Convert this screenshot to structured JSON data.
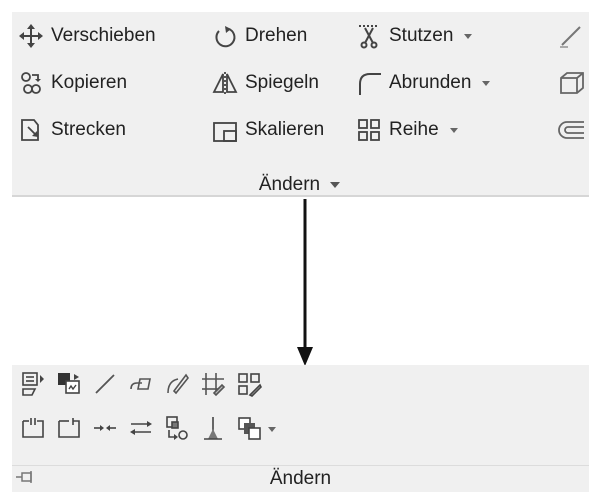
{
  "top_panel": {
    "tools": [
      {
        "label": "Verschieben",
        "icon": "move-icon"
      },
      {
        "label": "Drehen",
        "icon": "rotate-icon"
      },
      {
        "label": "Stutzen",
        "icon": "trim-icon",
        "dropdown": true
      },
      {
        "label": "Kopieren",
        "icon": "copy-icon"
      },
      {
        "label": "Spiegeln",
        "icon": "mirror-icon"
      },
      {
        "label": "Abrunden",
        "icon": "fillet-icon",
        "dropdown": true
      },
      {
        "label": "Strecken",
        "icon": "stretch-icon"
      },
      {
        "label": "Skalieren",
        "icon": "scale-icon"
      },
      {
        "label": "Reihe",
        "icon": "array-icon",
        "dropdown": true
      }
    ],
    "title": "Ändern"
  },
  "bottom_panel": {
    "title": "Ändern",
    "row1_icons": [
      "properties-edit-icon",
      "match-properties-icon",
      "line-edit-icon",
      "eraser-icon",
      "pencil-edit-icon",
      "trim-extend-icon",
      "array-edit-icon"
    ],
    "row2_icons": [
      "break-icon",
      "break-at-point-icon",
      "join-icon",
      "reverse-icon",
      "align-icon",
      "lengthen-icon",
      "draw-order-icon"
    ]
  },
  "colors": {
    "panel_bg": "#f0f0f0",
    "icon_gray": "#555555",
    "arrow": "#111111"
  }
}
